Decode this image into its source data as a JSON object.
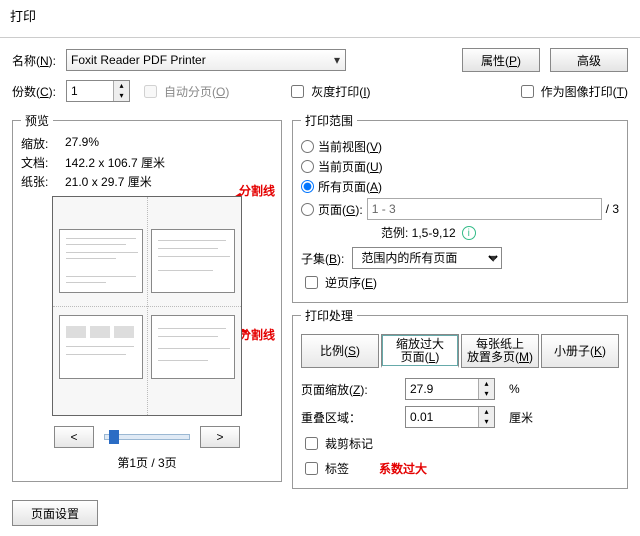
{
  "title": "打印",
  "top": {
    "name_label_pre": "名称(",
    "name_label_key": "N",
    "name_label_post": "):",
    "printer": "Foxit Reader PDF Printer",
    "properties_pre": "属性(",
    "properties_key": "P",
    "properties_post": ")",
    "advanced": "高级",
    "copies_label_pre": "份数(",
    "copies_label_key": "C",
    "copies_label_post": "):",
    "copies_value": "1",
    "collate_pre": "自动分页(",
    "collate_key": "O",
    "collate_post": ")",
    "gray_pre": "灰度打印(",
    "gray_key": "I",
    "gray_post": ")",
    "as_image_pre": "作为图像打印(",
    "as_image_key": "T",
    "as_image_post": ")"
  },
  "preview": {
    "legend": "预览",
    "scale_lbl": "缩放:",
    "scale_val": "27.9%",
    "doc_lbl": "文档:",
    "doc_val": "142.2 x 106.7 厘米",
    "paper_lbl": "纸张:",
    "paper_val": "21.0 x 29.7 厘米",
    "ann1": "分割线",
    "ann2": "分割线",
    "prev": "<",
    "next": ">",
    "page_of": "第1页 / 3页"
  },
  "range": {
    "legend": "打印范围",
    "r1_pre": "当前视图(",
    "r1_key": "V",
    "r1_post": ")",
    "r2_pre": "当前页面(",
    "r2_key": "U",
    "r2_post": ")",
    "r3_pre": "所有页面(",
    "r3_key": "A",
    "r3_post": ")",
    "r4_pre": "页面(",
    "r4_key": "G",
    "r4_post": "):",
    "r4_value": "1 - 3",
    "r4_total": "/ 3",
    "example": "范例: 1,5-9,12",
    "subset_pre": "子集(",
    "subset_key": "B",
    "subset_post": "):",
    "subset_val": "范围内的所有页面",
    "reverse_pre": "逆页序(",
    "reverse_key": "E",
    "reverse_post": ")"
  },
  "handling": {
    "legend": "打印处理",
    "t1_pre": "比例(",
    "t1_key": "S",
    "t1_post": ")",
    "t2a": "缩放过大",
    "t2b_pre": "页面(",
    "t2b_key": "L",
    "t2b_post": ")",
    "t3a": "每张纸上",
    "t3b_pre": "放置多页(",
    "t3b_key": "M",
    "t3b_post": ")",
    "t4_pre": "小册子(",
    "t4_key": "K",
    "t4_post": ")",
    "zoom_pre": "页面缩放(",
    "zoom_key": "Z",
    "zoom_post": "):",
    "zoom_val": "27.9",
    "zoom_unit": "%",
    "overlap_lbl": "重叠区域：",
    "overlap_val": "0.01",
    "overlap_unit": "厘米",
    "cut_marks": "裁剪标记",
    "labels": "标签",
    "warn": "系数过大"
  },
  "footer": {
    "page_setup": "页面设置"
  }
}
